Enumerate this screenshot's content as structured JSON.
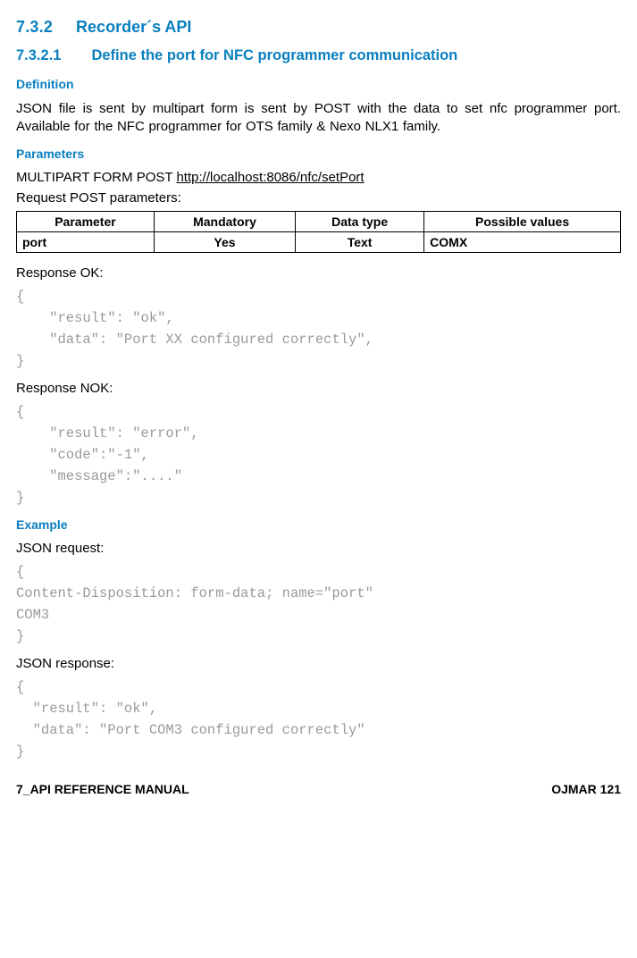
{
  "section": {
    "num": "7.3.2",
    "title": "Recorder´s API"
  },
  "subsection": {
    "num": "7.3.2.1",
    "title": "Define the port for NFC programmer communication"
  },
  "definition": {
    "label": "Definition",
    "text": "JSON file is sent by multipart form is sent by POST with the data to set nfc programmer port. Available for the NFC programmer for OTS family & Nexo NLX1 family."
  },
  "parameters": {
    "label": "Parameters",
    "method_line": "MULTIPART FORM POST ",
    "url": "http://localhost:8086/nfc/setPort",
    "request_label": "Request POST parameters:",
    "headers": [
      "Parameter",
      "Mandatory",
      "Data type",
      "Possible values"
    ],
    "rows": [
      {
        "param": "port",
        "mandatory": "Yes",
        "datatype": "Text",
        "values": "COMX"
      }
    ]
  },
  "response_ok": {
    "label": "Response OK:",
    "code": "{\n    \"result\": \"ok\",\n    \"data\": \"Port XX configured correctly\",\n}"
  },
  "response_nok": {
    "label": "Response NOK:",
    "code": "{\n    \"result\": \"error\",\n    \"code\":\"-1\",\n    \"message\":\"....\"\n}"
  },
  "example": {
    "label": "Example",
    "req_label": "JSON request:",
    "req_code": "{\nContent-Disposition: form-data; name=\"port\"\nCOM3\n}",
    "res_label": "JSON response:",
    "res_code": "{\n  \"result\": \"ok\",\n  \"data\": \"Port COM3 configured correctly\"\n}"
  },
  "footer": {
    "left": "7_API REFERENCE MANUAL",
    "right": "OJMAR 121"
  }
}
